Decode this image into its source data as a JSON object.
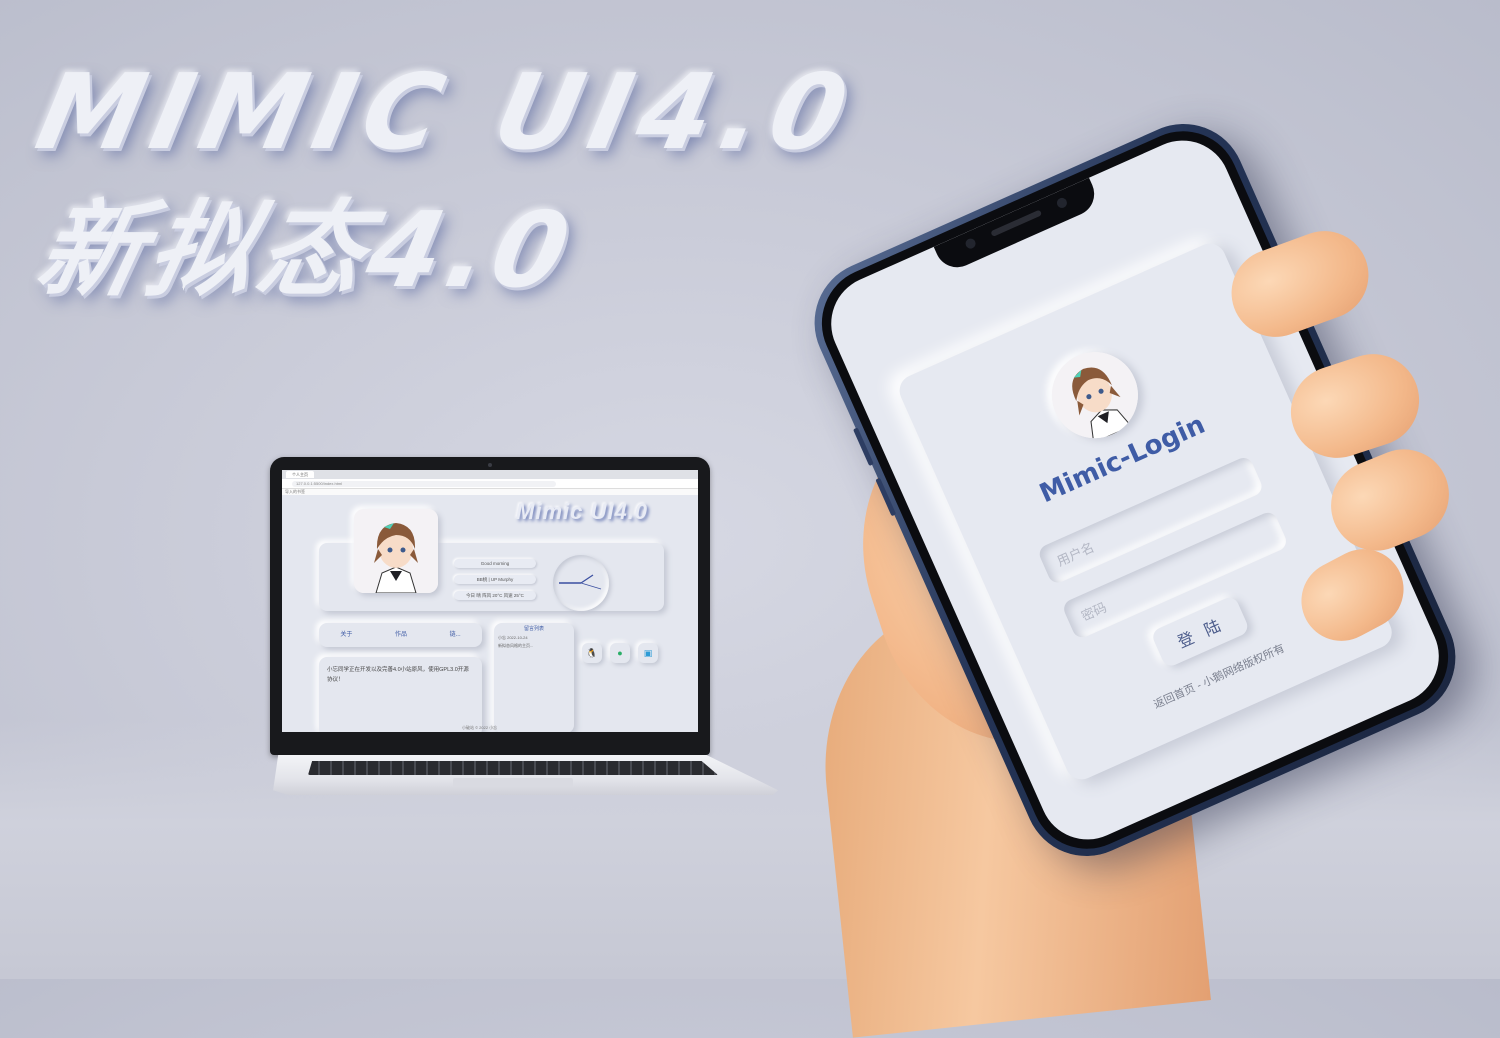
{
  "hero": {
    "line1": "MIMIC UI4.0",
    "line2": "新拟态4.0"
  },
  "laptop": {
    "browser_tab": "个人主页",
    "url": "127.0.0.1:5500/index.html",
    "bookmarks_label": "导入的书签",
    "site_title": "Mimic UI4.0",
    "greeting": "Good morning",
    "author": "BB桃 | UP Murphy",
    "weather": "今日 晴 阵风 20°C 风速 25°C",
    "tabs": [
      "关于",
      "作品",
      "链..."
    ],
    "about_text": "小忘同学正在开发以及完善4.0小站原风，使用GPL3.0开源协议！",
    "guestbook_title": "留言列表",
    "guestbook_entry": "小忘 2022-10-24",
    "guestbook_text": "新拟态风格的主页...",
    "footer_text": "小破站 © 2022 小忘"
  },
  "phone": {
    "login_title": "Mimic-Login",
    "username_placeholder": "用户名",
    "password_placeholder": "密码",
    "login_button": "登 陆",
    "footer": "返回首页 - 小鹅网络版权所有"
  },
  "colors": {
    "accent": "#3f5ca6",
    "neumorph_bg": "#e6e9f1",
    "background": "#c9cbd8"
  },
  "icons": [
    "qq-icon",
    "wechat-icon",
    "bilibili-icon",
    "clock-icon"
  ]
}
